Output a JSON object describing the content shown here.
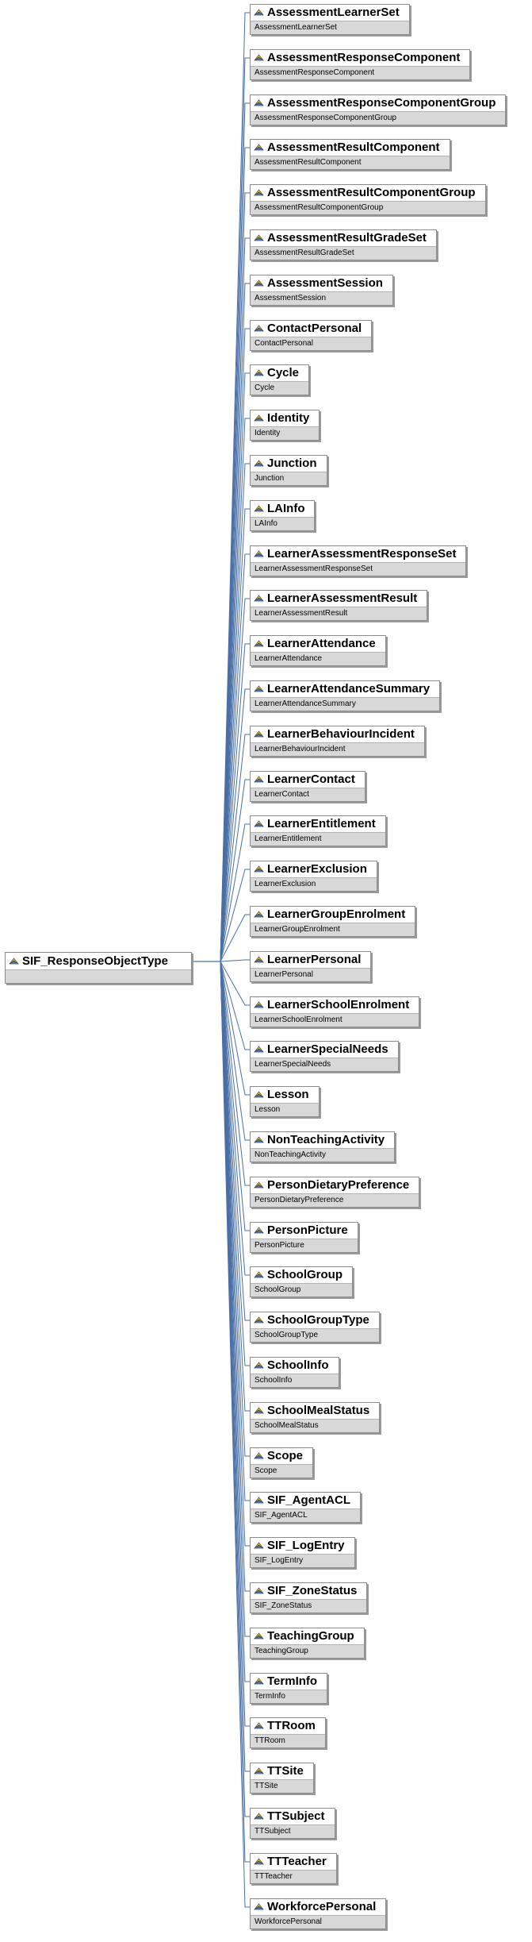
{
  "root": {
    "title": "SIF_ResponseObjectType",
    "icon": "element-icon"
  },
  "children": [
    {
      "title": "AssessmentLearnerSet",
      "type": "AssessmentLearnerSet"
    },
    {
      "title": "AssessmentResponseComponent",
      "type": "AssessmentResponseComponent"
    },
    {
      "title": "AssessmentResponseComponentGroup",
      "type": "AssessmentResponseComponentGroup"
    },
    {
      "title": "AssessmentResultComponent",
      "type": "AssessmentResultComponent"
    },
    {
      "title": "AssessmentResultComponentGroup",
      "type": "AssessmentResultComponentGroup"
    },
    {
      "title": "AssessmentResultGradeSet",
      "type": "AssessmentResultGradeSet"
    },
    {
      "title": "AssessmentSession",
      "type": "AssessmentSession"
    },
    {
      "title": "ContactPersonal",
      "type": "ContactPersonal"
    },
    {
      "title": "Cycle",
      "type": "Cycle"
    },
    {
      "title": "Identity",
      "type": "Identity"
    },
    {
      "title": "Junction",
      "type": "Junction"
    },
    {
      "title": "LAInfo",
      "type": "LAInfo"
    },
    {
      "title": "LearnerAssessmentResponseSet",
      "type": "LearnerAssessmentResponseSet"
    },
    {
      "title": "LearnerAssessmentResult",
      "type": "LearnerAssessmentResult"
    },
    {
      "title": "LearnerAttendance",
      "type": "LearnerAttendance"
    },
    {
      "title": "LearnerAttendanceSummary",
      "type": "LearnerAttendanceSummary"
    },
    {
      "title": "LearnerBehaviourIncident",
      "type": "LearnerBehaviourIncident"
    },
    {
      "title": "LearnerContact",
      "type": "LearnerContact"
    },
    {
      "title": "LearnerEntitlement",
      "type": "LearnerEntitlement"
    },
    {
      "title": "LearnerExclusion",
      "type": "LearnerExclusion"
    },
    {
      "title": "LearnerGroupEnrolment",
      "type": "LearnerGroupEnrolment"
    },
    {
      "title": "LearnerPersonal",
      "type": "LearnerPersonal"
    },
    {
      "title": "LearnerSchoolEnrolment",
      "type": "LearnerSchoolEnrolment"
    },
    {
      "title": "LearnerSpecialNeeds",
      "type": "LearnerSpecialNeeds"
    },
    {
      "title": "Lesson",
      "type": "Lesson"
    },
    {
      "title": "NonTeachingActivity",
      "type": "NonTeachingActivity"
    },
    {
      "title": "PersonDietaryPreference",
      "type": "PersonDietaryPreference"
    },
    {
      "title": "PersonPicture",
      "type": "PersonPicture"
    },
    {
      "title": "SchoolGroup",
      "type": "SchoolGroup"
    },
    {
      "title": "SchoolGroupType",
      "type": "SchoolGroupType"
    },
    {
      "title": "SchoolInfo",
      "type": "SchoolInfo"
    },
    {
      "title": "SchoolMealStatus",
      "type": "SchoolMealStatus"
    },
    {
      "title": "Scope",
      "type": "Scope"
    },
    {
      "title": "SIF_AgentACL",
      "type": "SIF_AgentACL"
    },
    {
      "title": "SIF_LogEntry",
      "type": "SIF_LogEntry"
    },
    {
      "title": "SIF_ZoneStatus",
      "type": "SIF_ZoneStatus"
    },
    {
      "title": "TeachingGroup",
      "type": "TeachingGroup"
    },
    {
      "title": "TermInfo",
      "type": "TermInfo"
    },
    {
      "title": "TTRoom",
      "type": "TTRoom"
    },
    {
      "title": "TTSite",
      "type": "TTSite"
    },
    {
      "title": "TTSubject",
      "type": "TTSubject"
    },
    {
      "title": "TTTeacher",
      "type": "TTTeacher"
    },
    {
      "title": "WorkforcePersonal",
      "type": "WorkforcePersonal"
    }
  ],
  "colors": {
    "connector": "#4a6fa5",
    "type_band": "#d8d8d8",
    "border": "#8c8c8c"
  }
}
